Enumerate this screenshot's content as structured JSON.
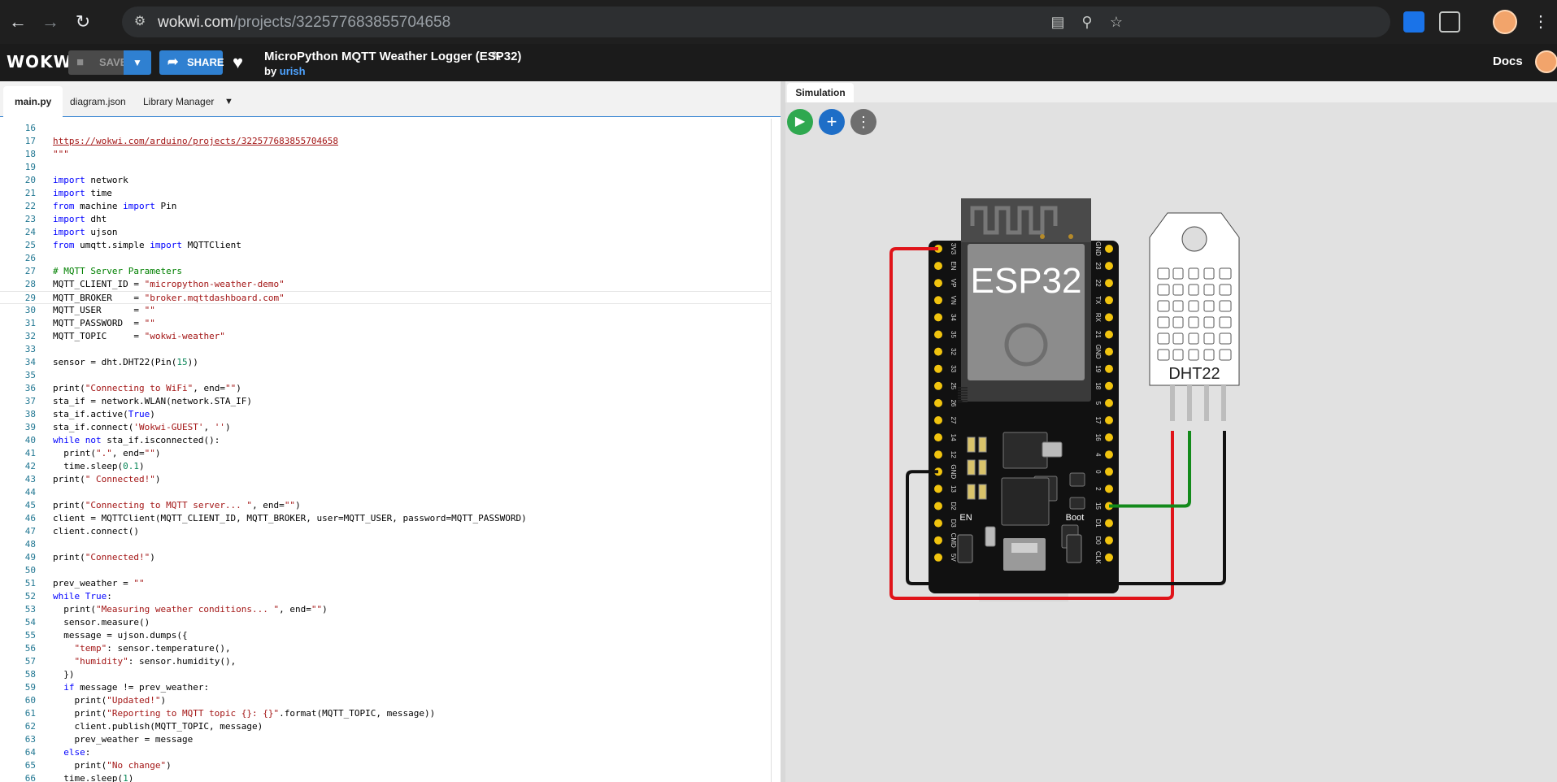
{
  "browser": {
    "url_host": "wokwi.com",
    "url_path": "/projects/322577683855704658"
  },
  "header": {
    "logo": "WOKWi",
    "save_label": "SAVE",
    "share_label": "SHARE",
    "project_title": "MicroPython MQTT Weather Logger (ESP32)",
    "by_label": "by",
    "author": "urish",
    "docs_label": "Docs"
  },
  "editor": {
    "tabs": [
      {
        "label": "main.py",
        "active": true
      },
      {
        "label": "diagram.json",
        "active": false
      },
      {
        "label": "Library Manager",
        "active": false
      }
    ],
    "current_line": 29,
    "lines": [
      {
        "n": 16,
        "t": ""
      },
      {
        "n": 17,
        "t": "https://wokwi.com/arduino/projects/322577683855704658"
      },
      {
        "n": 18,
        "t": "\"\"\""
      },
      {
        "n": 19,
        "t": ""
      },
      {
        "n": 20,
        "t": "import network"
      },
      {
        "n": 21,
        "t": "import time"
      },
      {
        "n": 22,
        "t": "from machine import Pin"
      },
      {
        "n": 23,
        "t": "import dht"
      },
      {
        "n": 24,
        "t": "import ujson"
      },
      {
        "n": 25,
        "t": "from umqtt.simple import MQTTClient"
      },
      {
        "n": 26,
        "t": ""
      },
      {
        "n": 27,
        "t": "# MQTT Server Parameters"
      },
      {
        "n": 28,
        "t": "MQTT_CLIENT_ID = \"micropython-weather-demo\""
      },
      {
        "n": 29,
        "t": "MQTT_BROKER    = \"broker.mqttdashboard.com\""
      },
      {
        "n": 30,
        "t": "MQTT_USER      = \"\""
      },
      {
        "n": 31,
        "t": "MQTT_PASSWORD  = \"\""
      },
      {
        "n": 32,
        "t": "MQTT_TOPIC     = \"wokwi-weather\""
      },
      {
        "n": 33,
        "t": ""
      },
      {
        "n": 34,
        "t": "sensor = dht.DHT22(Pin(15))"
      },
      {
        "n": 35,
        "t": ""
      },
      {
        "n": 36,
        "t": "print(\"Connecting to WiFi\", end=\"\")"
      },
      {
        "n": 37,
        "t": "sta_if = network.WLAN(network.STA_IF)"
      },
      {
        "n": 38,
        "t": "sta_if.active(True)"
      },
      {
        "n": 39,
        "t": "sta_if.connect('Wokwi-GUEST', '')"
      },
      {
        "n": 40,
        "t": "while not sta_if.isconnected():"
      },
      {
        "n": 41,
        "t": "  print(\".\", end=\"\")"
      },
      {
        "n": 42,
        "t": "  time.sleep(0.1)"
      },
      {
        "n": 43,
        "t": "print(\" Connected!\")"
      },
      {
        "n": 44,
        "t": ""
      },
      {
        "n": 45,
        "t": "print(\"Connecting to MQTT server... \", end=\"\")"
      },
      {
        "n": 46,
        "t": "client = MQTTClient(MQTT_CLIENT_ID, MQTT_BROKER, user=MQTT_USER, password=MQTT_PASSWORD)"
      },
      {
        "n": 47,
        "t": "client.connect()"
      },
      {
        "n": 48,
        "t": ""
      },
      {
        "n": 49,
        "t": "print(\"Connected!\")"
      },
      {
        "n": 50,
        "t": ""
      },
      {
        "n": 51,
        "t": "prev_weather = \"\""
      },
      {
        "n": 52,
        "t": "while True:"
      },
      {
        "n": 53,
        "t": "  print(\"Measuring weather conditions... \", end=\"\")"
      },
      {
        "n": 54,
        "t": "  sensor.measure()"
      },
      {
        "n": 55,
        "t": "  message = ujson.dumps({"
      },
      {
        "n": 56,
        "t": "    \"temp\": sensor.temperature(),"
      },
      {
        "n": 57,
        "t": "    \"humidity\": sensor.humidity(),"
      },
      {
        "n": 58,
        "t": "  })"
      },
      {
        "n": 59,
        "t": "  if message != prev_weather:"
      },
      {
        "n": 60,
        "t": "    print(\"Updated!\")"
      },
      {
        "n": 61,
        "t": "    print(\"Reporting to MQTT topic {}: {}\".format(MQTT_TOPIC, message))"
      },
      {
        "n": 62,
        "t": "    client.publish(MQTT_TOPIC, message)"
      },
      {
        "n": 63,
        "t": "    prev_weather = message"
      },
      {
        "n": 64,
        "t": "  else:"
      },
      {
        "n": 65,
        "t": "    print(\"No change\")"
      },
      {
        "n": 66,
        "t": "  time.sleep(1)"
      },
      {
        "n": 67,
        "t": ""
      }
    ]
  },
  "simulation": {
    "tab_label": "Simulation",
    "board_label": "ESP32",
    "sensor_label": "DHT22",
    "button_en": "EN",
    "button_boot": "Boot",
    "pins_left": [
      "3V3",
      "EN",
      "VP",
      "VN",
      "34",
      "35",
      "32",
      "33",
      "25",
      "26",
      "27",
      "14",
      "12",
      "GND",
      "13",
      "D2",
      "D3",
      "CMD",
      "5V"
    ],
    "pins_right": [
      "GND",
      "23",
      "22",
      "TX",
      "RX",
      "21",
      "GND",
      "19",
      "18",
      "5",
      "17",
      "16",
      "4",
      "0",
      "2",
      "15",
      "D1",
      "D0",
      "CLK"
    ],
    "wire_colors": {
      "power": "#e0141a",
      "ground": "#111111",
      "data": "#138a1b"
    }
  }
}
